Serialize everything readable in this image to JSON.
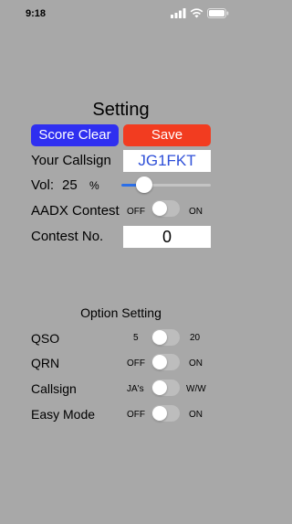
{
  "status_bar": {
    "time": "9:18"
  },
  "title": "Setting",
  "buttons": {
    "clear": "Score Clear",
    "save": "Save"
  },
  "callsign": {
    "label": "Your Callsign",
    "value": "JG1FKT"
  },
  "volume": {
    "label": "Vol:",
    "value": "25",
    "unit": "%",
    "level": 0.25
  },
  "aadx": {
    "label": "AADX Contest",
    "off": "OFF",
    "on": "ON",
    "state": "off"
  },
  "contest_no": {
    "label": "Contest No.",
    "value": "0"
  },
  "option_setting": {
    "title": "Option Setting",
    "rows": [
      {
        "label": "QSO",
        "left": "5",
        "right": "20",
        "state": "left"
      },
      {
        "label": "QRN",
        "left": "OFF",
        "right": "ON",
        "state": "left"
      },
      {
        "label": "Callsign",
        "left": "JA's",
        "right": "W/W",
        "state": "left"
      },
      {
        "label": "Easy Mode",
        "left": "OFF",
        "right": "ON",
        "state": "left"
      }
    ]
  },
  "colors": {
    "background": "#a8a8a8",
    "clear_button": "#2f2ff0",
    "save_button": "#f23c20",
    "callsign_text": "#2f50d8",
    "slider_fill": "#2b6fe8"
  }
}
